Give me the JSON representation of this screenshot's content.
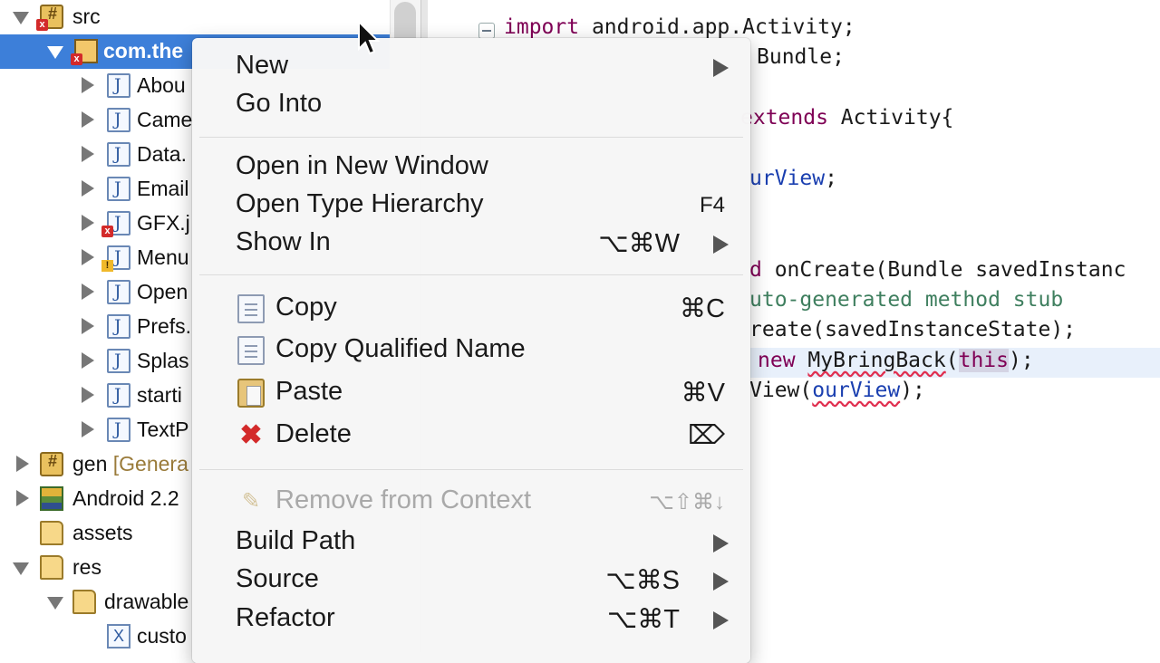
{
  "explorer": {
    "rows": [
      {
        "label": "src",
        "dec": ""
      },
      {
        "label": "com.the",
        "dec": ""
      },
      {
        "label": "Abou",
        "dec": ""
      },
      {
        "label": "Came",
        "dec": ""
      },
      {
        "label": "Data.",
        "dec": ""
      },
      {
        "label": "Email",
        "dec": ""
      },
      {
        "label": "GFX.j",
        "dec": ""
      },
      {
        "label": "Menu",
        "dec": ""
      },
      {
        "label": "Open",
        "dec": ""
      },
      {
        "label": "Prefs.",
        "dec": ""
      },
      {
        "label": "Splas",
        "dec": ""
      },
      {
        "label": "starti",
        "dec": ""
      },
      {
        "label": "TextP",
        "dec": ""
      },
      {
        "label": "gen",
        "dec": " [Genera"
      },
      {
        "label": "Android 2.2",
        "dec": ""
      },
      {
        "label": "assets",
        "dec": ""
      },
      {
        "label": "res",
        "dec": ""
      },
      {
        "label": "drawable",
        "dec": ""
      },
      {
        "label": "custo",
        "dec": ""
      }
    ]
  },
  "editor": {
    "l1_kw": "import",
    "l1_rest": " android.app.Activity;",
    "l2": "Bundle;",
    "l3_kw": "extends",
    "l3_rest": " Activity{",
    "l4_field": "urView",
    "l4_rest": ";",
    "l5_kw": "d",
    "l5_rest": " onCreate(Bundle savedInstanc",
    "l6": "uto-generated method stub",
    "l7": "reate(savedInstanceState);",
    "l8_kw": "new",
    "l8_sp": " ",
    "l8_cls": "MyBringBack",
    "l8_open": "(",
    "l8_this": "this",
    "l8_close": ");",
    "l9_pre": "View(",
    "l9_field": "ourView",
    "l9_post": ");"
  },
  "menu": {
    "items": [
      {
        "label": "New",
        "shortcut": "",
        "submenu": true
      },
      {
        "label": "Go Into",
        "shortcut": ""
      },
      {
        "label": "Open in New Window",
        "shortcut": ""
      },
      {
        "label": "Open Type Hierarchy",
        "shortcut": "F4"
      },
      {
        "label": "Show In",
        "shortcut": "⌥⌘W",
        "submenu": true
      },
      {
        "label": "Copy",
        "shortcut": "⌘C",
        "icon": "copy-icon"
      },
      {
        "label": "Copy Qualified Name",
        "shortcut": "",
        "icon": "copy-qualified-icon"
      },
      {
        "label": "Paste",
        "shortcut": "⌘V",
        "icon": "paste-icon"
      },
      {
        "label": "Delete",
        "shortcut": "⌦",
        "icon": "delete-icon"
      },
      {
        "label": "Remove from Context",
        "shortcut": "⌥⇧⌘↓",
        "disabled": true,
        "icon": "remove-context-icon"
      },
      {
        "label": "Build Path",
        "shortcut": "",
        "submenu": true
      },
      {
        "label": "Source",
        "shortcut": "⌥⌘S",
        "submenu": true
      },
      {
        "label": "Refactor",
        "shortcut": "⌥⌘T",
        "submenu": true
      }
    ],
    "delete_glyph": "✖"
  },
  "colors": {
    "selection": "#3d7fd9",
    "keyword": "#7f0055",
    "comment": "#3f7f5f",
    "field": "#1a3fb0",
    "error": "#d32a2a"
  }
}
